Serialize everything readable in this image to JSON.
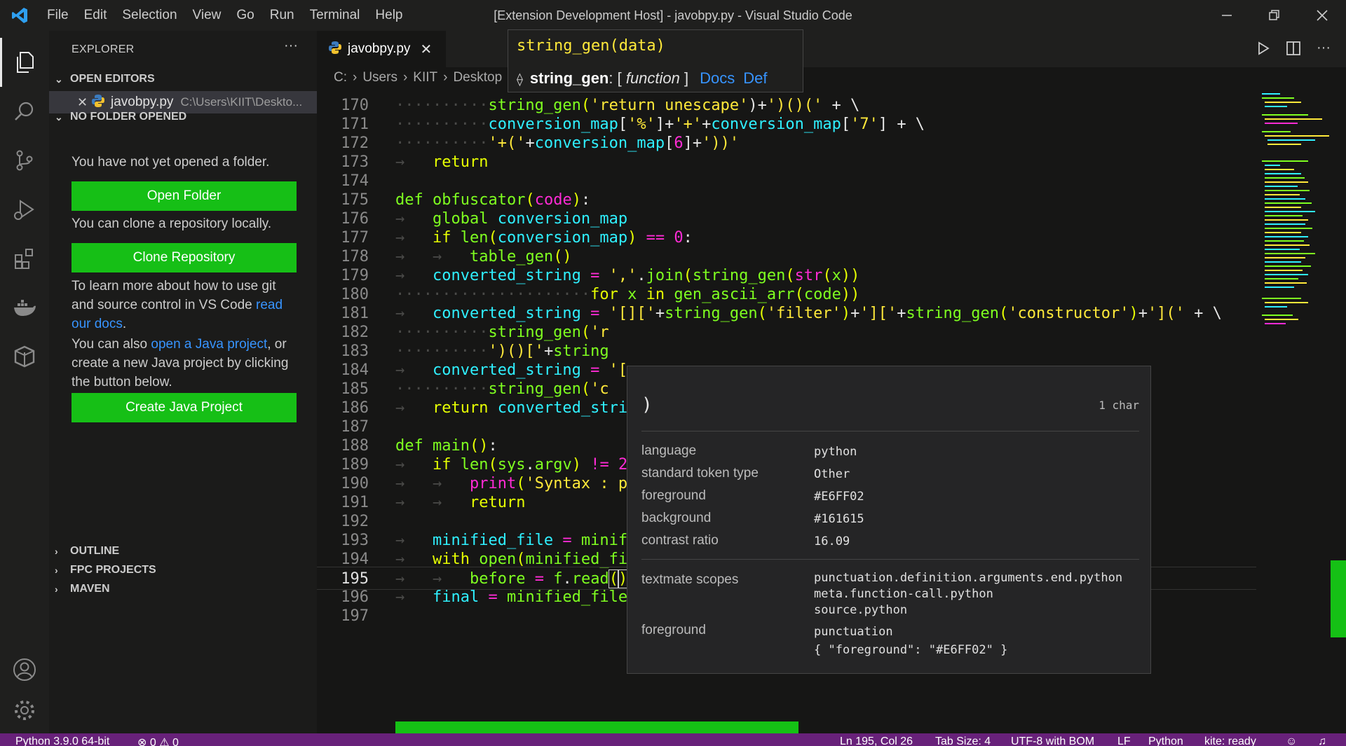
{
  "titlebar": {
    "menu": [
      "File",
      "Edit",
      "Selection",
      "View",
      "Go",
      "Run",
      "Terminal",
      "Help"
    ],
    "title": "[Extension Development Host] - javobpy.py - Visual Studio Code"
  },
  "sidebar": {
    "header": "EXPLORER",
    "open_editors_label": "OPEN EDITORS",
    "open_editor": {
      "name": "javobpy.py",
      "path": "C:\\Users\\KIIT\\Deskto..."
    },
    "no_folder_label": "NO FOLDER OPENED",
    "msg_no_folder": "You have not yet opened a folder.",
    "open_folder_btn": "Open Folder",
    "msg_clone": "You can clone a repository locally.",
    "clone_btn": "Clone Repository",
    "msg_git_pre": "To learn more about how to use git and source control in VS Code ",
    "msg_git_link": "read our docs",
    "msg_git_post": ".",
    "msg_java_pre": "You can also ",
    "msg_java_link": "open a Java project",
    "msg_java_post": ", or create a new Java project by clicking the button below.",
    "create_java_btn": "Create Java Project",
    "outline": "OUTLINE",
    "fpc": "FPC PROJECTS",
    "maven": "MAVEN"
  },
  "editor": {
    "tab": "javobpy.py",
    "breadcrumb": [
      "C:",
      "Users",
      "KIIT",
      "Desktop"
    ],
    "current_line": 195
  },
  "signature": {
    "text": "string_gen(data)",
    "name": "string_gen",
    "kind": "function",
    "docs": "Docs",
    "def": "Def"
  },
  "inspect": {
    "char": ")",
    "length": "1 char",
    "rows": [
      {
        "key": "language",
        "value": "python"
      },
      {
        "key": "standard token type",
        "value": "Other"
      },
      {
        "key": "foreground",
        "value": "#E6FF02"
      },
      {
        "key": "background",
        "value": "#161615"
      },
      {
        "key": "contrast ratio",
        "value": "16.09"
      }
    ],
    "scopes_label": "textmate scopes",
    "scopes": "punctuation.definition.arguments.end.python\nmeta.function-call.python\nsource.python",
    "fg_label": "foreground",
    "fg_value": "punctuation\n{ \"foreground\": \"#E6FF02\" }"
  },
  "status": {
    "python": "Python 3.9.0 64-bit",
    "problems": "⊗ 0 ⚠ 0",
    "position": "Ln 195, Col 26",
    "tab_size": "Tab Size: 4",
    "encoding": "UTF-8 with BOM",
    "eol": "LF",
    "language": "Python",
    "kite": "kite: ready"
  },
  "colors": {
    "accent_button": "#16bf16",
    "status_bar": "#68217a",
    "token_foreground": "#E6FF02",
    "editor_background": "#161615"
  }
}
